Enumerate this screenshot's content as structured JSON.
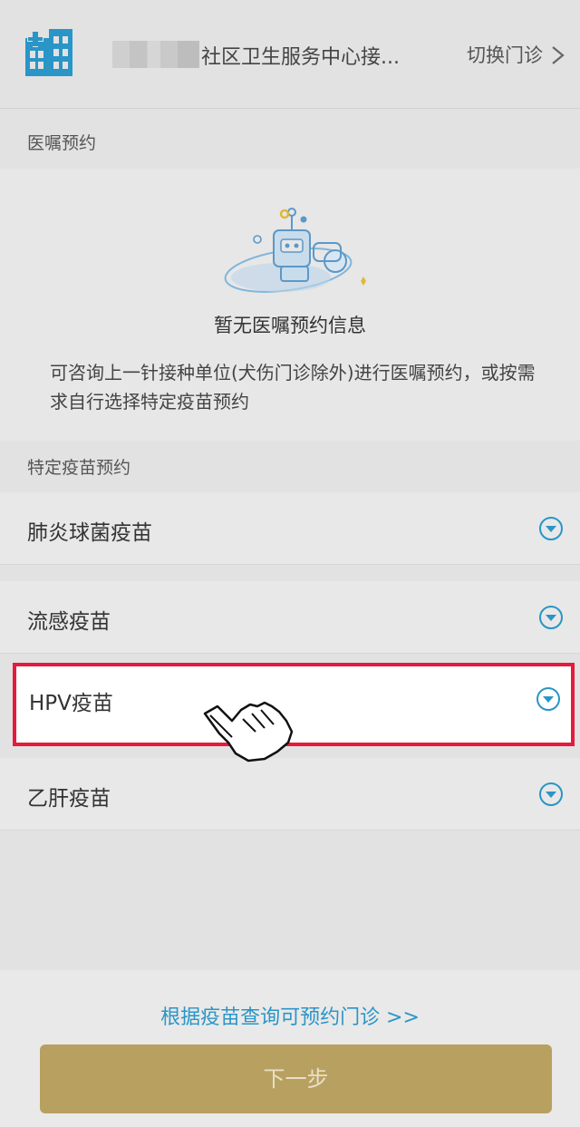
{
  "header": {
    "clinic_name": "社区卫生服务中心接...",
    "switch_label": "切换门诊"
  },
  "doctor_order": {
    "section_title": "医嘱预约",
    "empty_title": "暂无医嘱预约信息",
    "empty_desc": "可咨询上一针接种单位(犬伤门诊除外)进行医嘱预约，或按需求自行选择特定疫苗预约"
  },
  "specific_vaccine": {
    "section_title": "特定疫苗预约",
    "items": [
      {
        "label": "肺炎球菌疫苗"
      },
      {
        "label": "流感疫苗"
      },
      {
        "label": "HPV疫苗"
      },
      {
        "label": "乙肝疫苗"
      }
    ]
  },
  "footer": {
    "query_link": "根据疫苗查询可预约门诊 >>",
    "next_button": "下一步"
  },
  "colors": {
    "accent_blue": "#2a95c7",
    "button_gold": "#b8a060",
    "highlight_red": "#e61a3c"
  },
  "icons": {
    "hospital": "hospital-building-icon",
    "expand": "chevron-down-circle-icon",
    "cursor": "hand-pointer-icon"
  }
}
